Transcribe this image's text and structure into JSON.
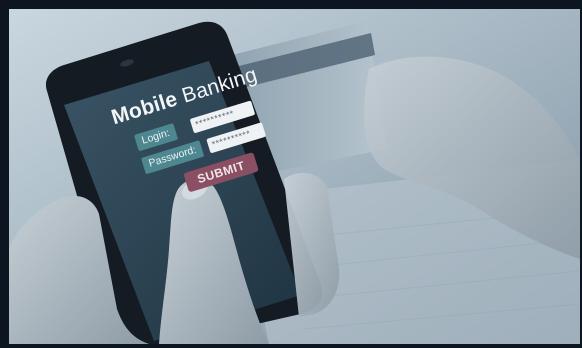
{
  "screen": {
    "title_bold": "Mobile",
    "title_light": "Banking",
    "login_label": "Login:",
    "login_value": "**********",
    "password_label": "Password:",
    "password_value": "**********",
    "submit_label": "SUBMIT"
  },
  "colors": {
    "frame": "#0d1520",
    "screen": "#2b4454",
    "label_bg": "#4f8791",
    "submit_bg": "#8a4f62"
  }
}
